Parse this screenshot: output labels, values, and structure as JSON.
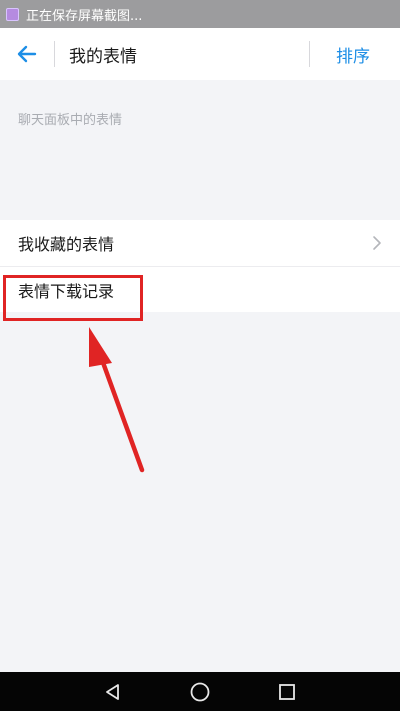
{
  "status_bar": {
    "notification_text": "正在保存屏幕截图..."
  },
  "header": {
    "back_icon": "back-arrow-icon",
    "title": "我的表情",
    "sort_label": "排序"
  },
  "section": {
    "label": "聊天面板中的表情"
  },
  "list": {
    "items": [
      {
        "label": "我收藏的表情",
        "icon": "chevron-right-icon"
      },
      {
        "label": "表情下载记录"
      }
    ]
  },
  "annotation": {
    "highlight_color": "#e02424",
    "highlighted_item": "表情下载记录"
  },
  "nav_bar": {
    "buttons": [
      "back-triangle-icon",
      "home-circle-icon",
      "recents-square-icon"
    ]
  },
  "colors": {
    "accent": "#1d8ee6",
    "background": "#f3f4f7"
  }
}
